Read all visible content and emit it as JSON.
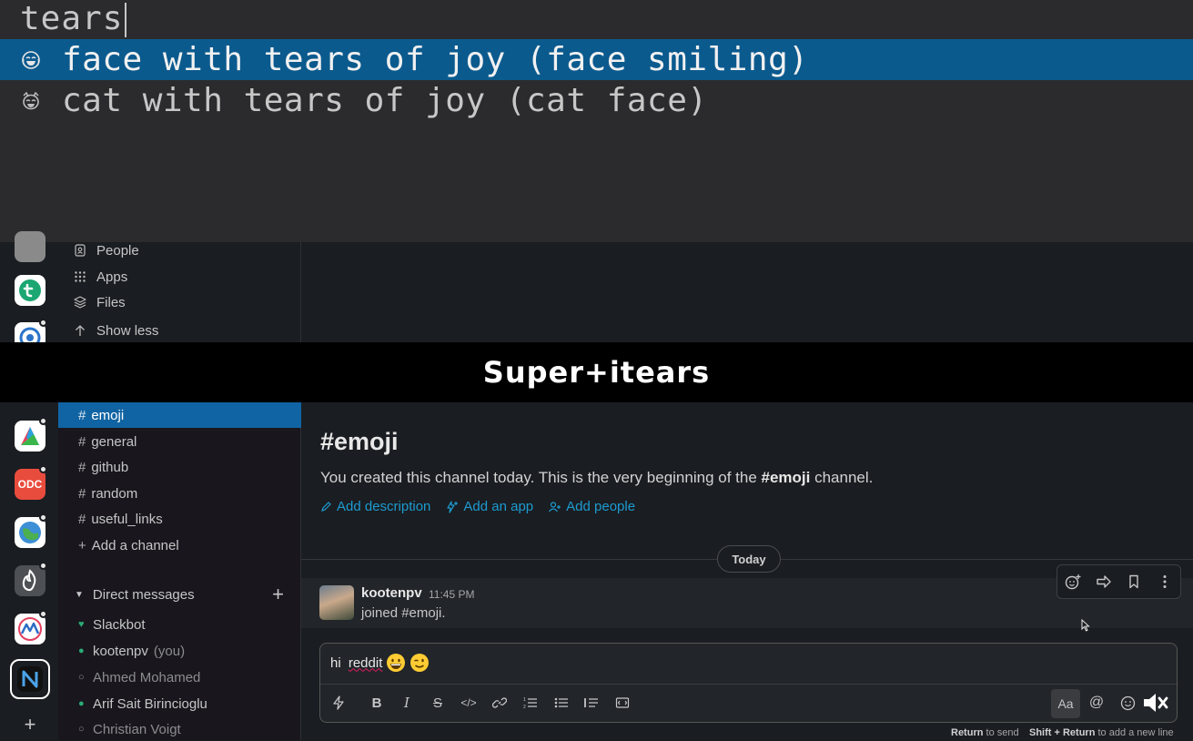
{
  "picker": {
    "query": "tears",
    "results": [
      {
        "label": "face with tears of joy (face smiling)",
        "icon": "face-tears-of-joy-icon",
        "selected": true
      },
      {
        "label": "cat with tears of joy (cat face)",
        "icon": "cat-tears-of-joy-icon",
        "selected": false
      }
    ]
  },
  "sidebar_top": {
    "items": [
      {
        "label": "People",
        "icon": "contact-card-icon"
      },
      {
        "label": "Apps",
        "icon": "apps-grid-icon"
      },
      {
        "label": "Files",
        "icon": "layers-icon"
      },
      {
        "label": "Show less",
        "icon": "arrow-up-icon"
      }
    ]
  },
  "banner": {
    "text": "Super+itears"
  },
  "channels": [
    {
      "label": "emoji",
      "active": true
    },
    {
      "label": "general",
      "active": false
    },
    {
      "label": "github",
      "active": false
    },
    {
      "label": "random",
      "active": false
    },
    {
      "label": "useful_links",
      "active": false
    }
  ],
  "add_channel_label": "Add a channel",
  "direct_messages": {
    "heading": "Direct messages",
    "items": [
      {
        "name": "Slackbot",
        "note": "",
        "dim": false
      },
      {
        "name": "kootenpv",
        "note": "(you)",
        "dim": false
      },
      {
        "name": "Ahmed Mohamed",
        "note": "",
        "dim": true
      },
      {
        "name": "Arif Sait Birincioglu",
        "note": "",
        "dim": false
      },
      {
        "name": "Christian Voigt",
        "note": "",
        "dim": true
      }
    ]
  },
  "channel": {
    "title": "#emoji",
    "intro_prefix": "You created this channel today. This is the very beginning of the ",
    "intro_channel": "#emoji",
    "intro_suffix": " channel.",
    "actions": [
      "Add description",
      "Add an app",
      "Add people"
    ]
  },
  "date_divider": "Today",
  "message": {
    "author": "kootenpv",
    "time": "11:45 PM",
    "text": "joined #emoji."
  },
  "composer": {
    "text_plain": "hi ",
    "text_typo": "reddit",
    "aa_label": "Aa",
    "hint_return_key": "Return",
    "hint_return_text": " to send",
    "hint_shift_key": "Shift + Return",
    "hint_shift_text": " to add a new line"
  },
  "colors": {
    "selection": "#0b5a8e",
    "active_channel": "#1164a3",
    "link": "#1d9bd1"
  }
}
